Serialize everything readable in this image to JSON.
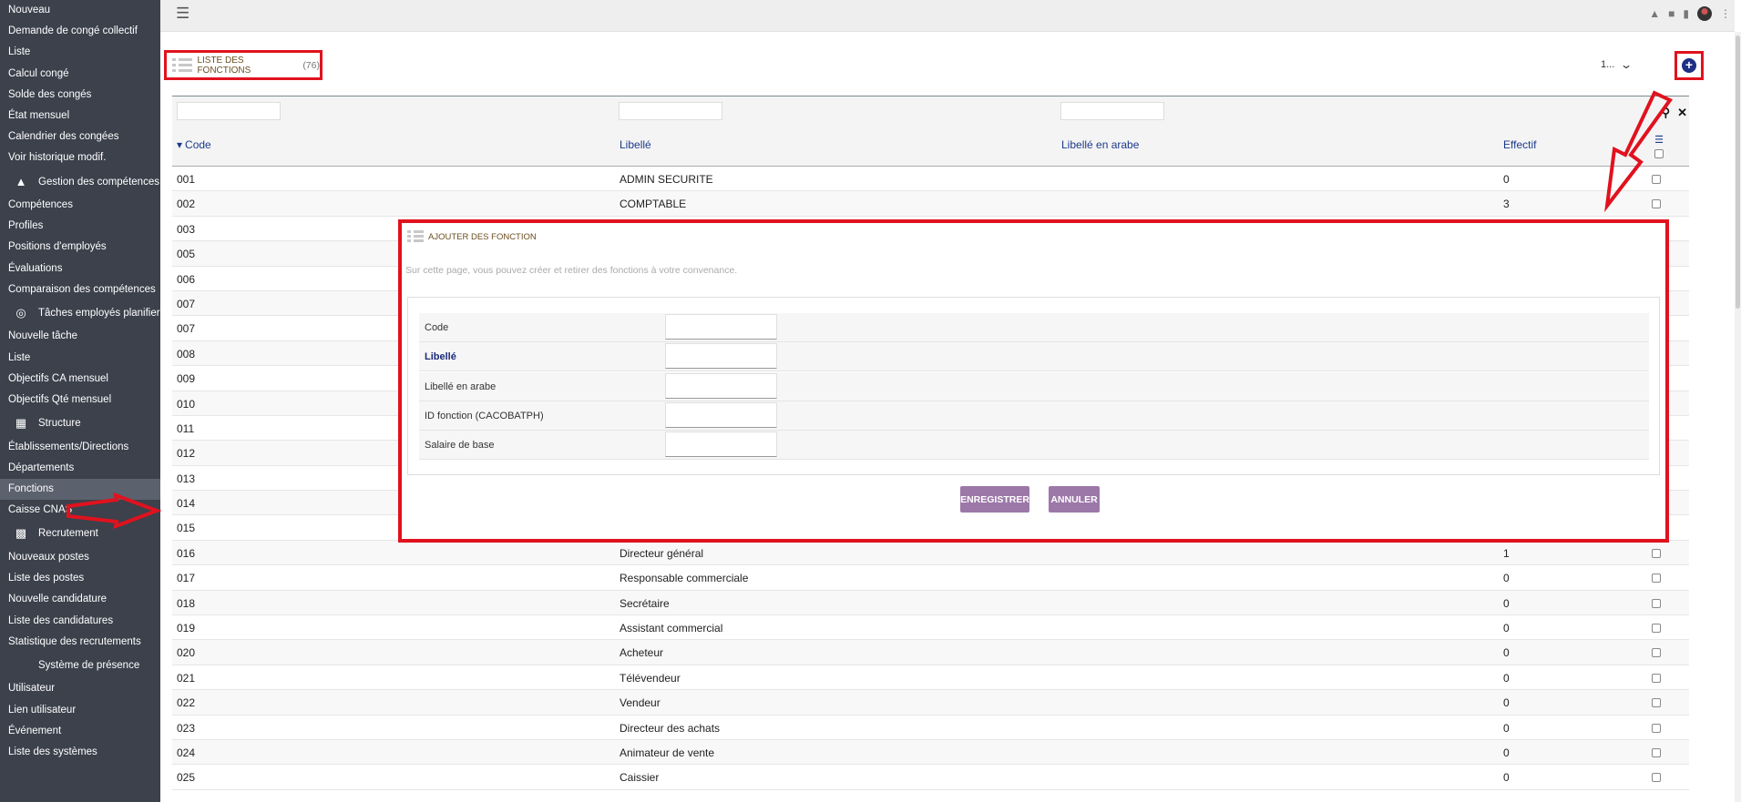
{
  "sidebar": {
    "items": [
      {
        "label": "Nouveau",
        "type": "link"
      },
      {
        "label": "Demande de congé collectif",
        "type": "link"
      },
      {
        "label": "Liste",
        "type": "link"
      },
      {
        "label": "Calcul congé",
        "type": "link"
      },
      {
        "label": "Solde des congés",
        "type": "link"
      },
      {
        "label": "État mensuel",
        "type": "link"
      },
      {
        "label": "Calendrier des congées",
        "type": "link"
      },
      {
        "label": "Voir historique modif.",
        "type": "link"
      },
      {
        "label": "Gestion des compétences",
        "type": "group",
        "icon": "shapes-icon"
      },
      {
        "label": "Compétences",
        "type": "link"
      },
      {
        "label": "Profiles",
        "type": "link"
      },
      {
        "label": "Positions d'employés",
        "type": "link"
      },
      {
        "label": "Évaluations",
        "type": "link"
      },
      {
        "label": "Comparaison des compétences",
        "type": "link"
      },
      {
        "label": "Tâches employés planifier",
        "type": "group",
        "icon": "target-icon"
      },
      {
        "label": "Nouvelle tâche",
        "type": "link"
      },
      {
        "label": "Liste",
        "type": "link"
      },
      {
        "label": "Objectifs CA mensuel",
        "type": "link"
      },
      {
        "label": "Objectifs Qté mensuel",
        "type": "link"
      },
      {
        "label": "Structure",
        "type": "group",
        "icon": "building-icon"
      },
      {
        "label": "Établissements/Directions",
        "type": "link"
      },
      {
        "label": "Départements",
        "type": "link"
      },
      {
        "label": "Fonctions",
        "type": "link",
        "active": true
      },
      {
        "label": "Caisse CNAS",
        "type": "link"
      },
      {
        "label": "Recrutement",
        "type": "group",
        "icon": "id-card-icon"
      },
      {
        "label": "Nouveaux postes",
        "type": "link"
      },
      {
        "label": "Liste des postes",
        "type": "link"
      },
      {
        "label": "Nouvelle candidature",
        "type": "link"
      },
      {
        "label": "Liste des candidatures",
        "type": "link"
      },
      {
        "label": "Statistique des recrutements",
        "type": "link"
      },
      {
        "label": "Système de présence",
        "type": "group",
        "icon": ""
      },
      {
        "label": "Utilisateur",
        "type": "link"
      },
      {
        "label": "Lien utilisateur",
        "type": "link"
      },
      {
        "label": "Événement",
        "type": "link"
      },
      {
        "label": "Liste des systèmes",
        "type": "link"
      }
    ]
  },
  "page": {
    "title": "LISTE DES FONCTIONS",
    "count": "(76)",
    "pager_value": "1..."
  },
  "table": {
    "columns": [
      "Code",
      "Libellé",
      "Libellé en arabe",
      "Effectif"
    ],
    "rows": [
      {
        "code": "001",
        "libelle": "ADMIN SECURITE",
        "arabe": "",
        "effectif": "0"
      },
      {
        "code": "002",
        "libelle": "COMPTABLE",
        "arabe": "",
        "effectif": "3"
      },
      {
        "code": "003",
        "libelle": "",
        "arabe": "",
        "effectif": ""
      },
      {
        "code": "005",
        "libelle": "",
        "arabe": "",
        "effectif": ""
      },
      {
        "code": "006",
        "libelle": "",
        "arabe": "",
        "effectif": ""
      },
      {
        "code": "007",
        "libelle": "",
        "arabe": "",
        "effectif": ""
      },
      {
        "code": "007",
        "libelle": "",
        "arabe": "",
        "effectif": ""
      },
      {
        "code": "008",
        "libelle": "",
        "arabe": "",
        "effectif": ""
      },
      {
        "code": "009",
        "libelle": "",
        "arabe": "",
        "effectif": ""
      },
      {
        "code": "010",
        "libelle": "",
        "arabe": "",
        "effectif": ""
      },
      {
        "code": "011",
        "libelle": "",
        "arabe": "",
        "effectif": ""
      },
      {
        "code": "012",
        "libelle": "",
        "arabe": "",
        "effectif": ""
      },
      {
        "code": "013",
        "libelle": "",
        "arabe": "",
        "effectif": ""
      },
      {
        "code": "014",
        "libelle": "",
        "arabe": "",
        "effectif": ""
      },
      {
        "code": "015",
        "libelle": "",
        "arabe": "",
        "effectif": ""
      },
      {
        "code": "016",
        "libelle": "Directeur général",
        "arabe": "",
        "effectif": "1"
      },
      {
        "code": "017",
        "libelle": "Responsable commerciale",
        "arabe": "",
        "effectif": "0"
      },
      {
        "code": "018",
        "libelle": "Secrétaire",
        "arabe": "",
        "effectif": "0"
      },
      {
        "code": "019",
        "libelle": "Assistant commercial",
        "arabe": "",
        "effectif": "0"
      },
      {
        "code": "020",
        "libelle": "Acheteur",
        "arabe": "",
        "effectif": "0"
      },
      {
        "code": "021",
        "libelle": "Télévendeur",
        "arabe": "",
        "effectif": "0"
      },
      {
        "code": "022",
        "libelle": "Vendeur",
        "arabe": "",
        "effectif": "0"
      },
      {
        "code": "023",
        "libelle": "Directeur des achats",
        "arabe": "",
        "effectif": "0"
      },
      {
        "code": "024",
        "libelle": "Animateur de vente",
        "arabe": "",
        "effectif": "0"
      },
      {
        "code": "025",
        "libelle": "Caissier",
        "arabe": "",
        "effectif": "0"
      }
    ]
  },
  "modal": {
    "title": "AJOUTER DES FONCTION",
    "description": "Sur cette page, vous pouvez créer et retirer des fonctions à votre convenance.",
    "fields": [
      {
        "label": "Code",
        "required": false,
        "value": ""
      },
      {
        "label": "Libellé",
        "required": true,
        "value": ""
      },
      {
        "label": "Libellé en arabe",
        "required": false,
        "value": ""
      },
      {
        "label": "ID fonction (CACOBATPH)",
        "required": false,
        "value": ""
      },
      {
        "label": "Salaire de base",
        "required": false,
        "value": ""
      }
    ],
    "save_label": "ENREGISTRER",
    "cancel_label": "ANNULER"
  },
  "colors": {
    "sidebar_bg": "#3c414c",
    "highlight_red": "#e0121e",
    "header_link": "#1c3a8c",
    "button_purple": "#9c78a8",
    "add_button": "#1d2f86"
  }
}
